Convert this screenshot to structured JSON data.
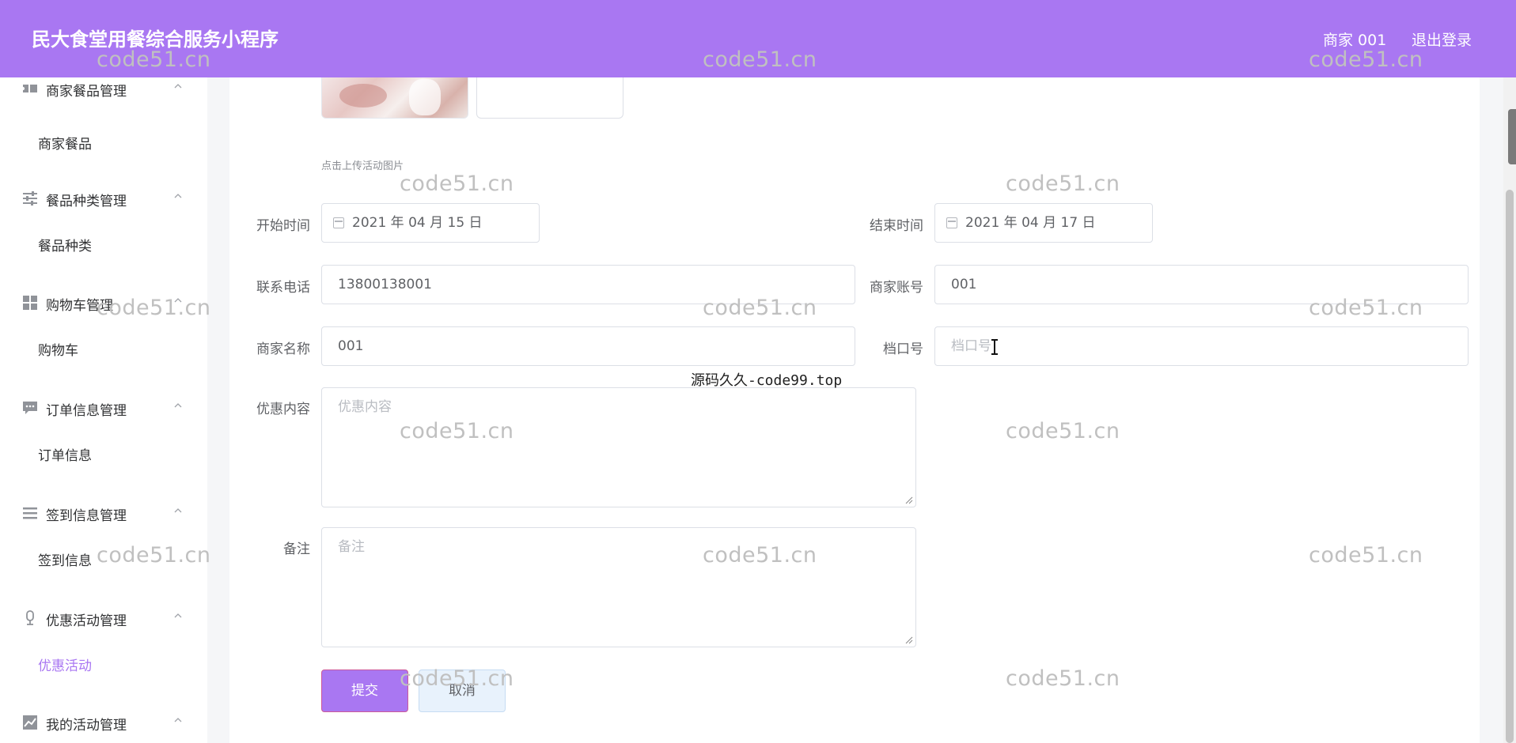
{
  "header": {
    "title": "民大食堂用餐综合服务小程序",
    "user": "商家 001",
    "logout": "退出登录"
  },
  "colors": {
    "accent": "#a977f2",
    "cancel_bg": "#e8f2fc"
  },
  "sidebar": {
    "groups": [
      {
        "icon": "ticket-icon",
        "label": "商家餐品管理",
        "sub": "商家餐品"
      },
      {
        "icon": "sliders-icon",
        "label": "餐品种类管理",
        "sub": "餐品种类"
      },
      {
        "icon": "grid-icon",
        "label": "购物车管理",
        "sub": "购物车"
      },
      {
        "icon": "chat-icon",
        "label": "订单信息管理",
        "sub": "订单信息"
      },
      {
        "icon": "list-icon",
        "label": "签到信息管理",
        "sub": "签到信息"
      },
      {
        "icon": "mic-icon",
        "label": "优惠活动管理",
        "sub": "优惠活动"
      },
      {
        "icon": "chart-icon",
        "label": "我的活动管理",
        "sub": ""
      }
    ],
    "active_sub": "优惠活动"
  },
  "form": {
    "upload_tip": "点击上传活动图片",
    "start_label": "开始时间",
    "start_value": "2021 年 04 月 15 日",
    "end_label": "结束时间",
    "end_value": "2021 年 04 月 17 日",
    "phone_label": "联系电话",
    "phone_value": "13800138001",
    "account_label": "商家账号",
    "account_value": "001",
    "name_label": "商家名称",
    "name_value": "001",
    "stall_label": "档口号",
    "stall_placeholder": "档口号",
    "discount_label": "优惠内容",
    "discount_placeholder": "优惠内容",
    "remark_label": "备注",
    "remark_placeholder": "备注",
    "submit": "提交",
    "cancel": "取消"
  },
  "watermark": {
    "text": "code51.cn",
    "center_text": "源码久久-code99.top"
  }
}
